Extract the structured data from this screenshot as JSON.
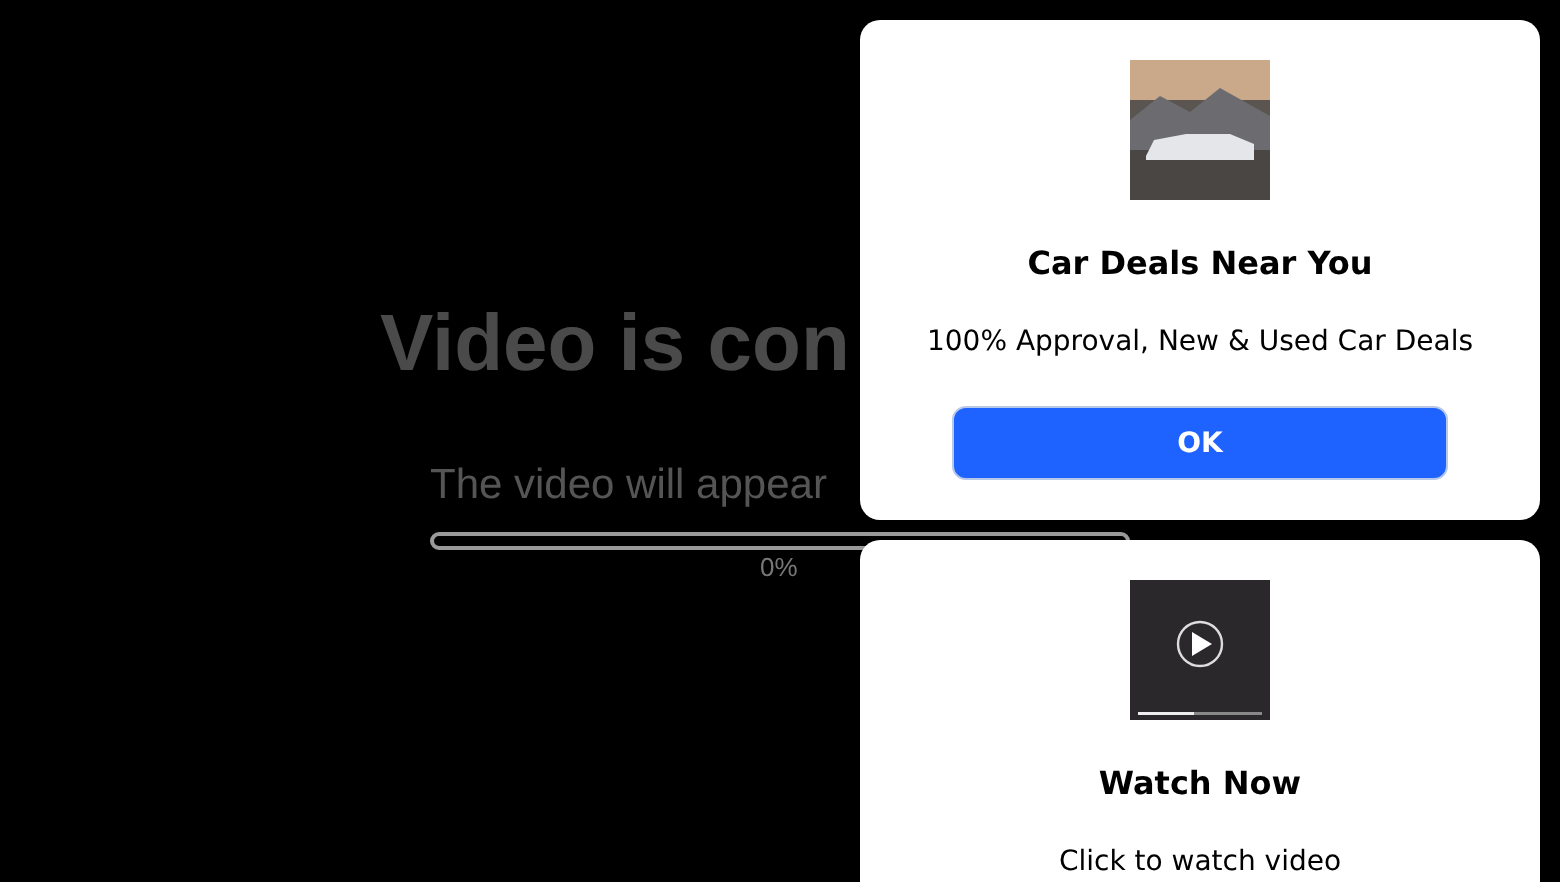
{
  "background_page": {
    "title": "Video is con",
    "subtitle": "The video will appear",
    "progress": {
      "level": 0,
      "reading": "0%"
    }
  },
  "popups": [
    {
      "kind": "photo",
      "title": "Car Deals Near You",
      "text": "100% Approval, New & Used Car Deals",
      "button": "OK"
    },
    {
      "kind": "video",
      "title": "Watch Now",
      "text": "Click to watch video"
    }
  ]
}
